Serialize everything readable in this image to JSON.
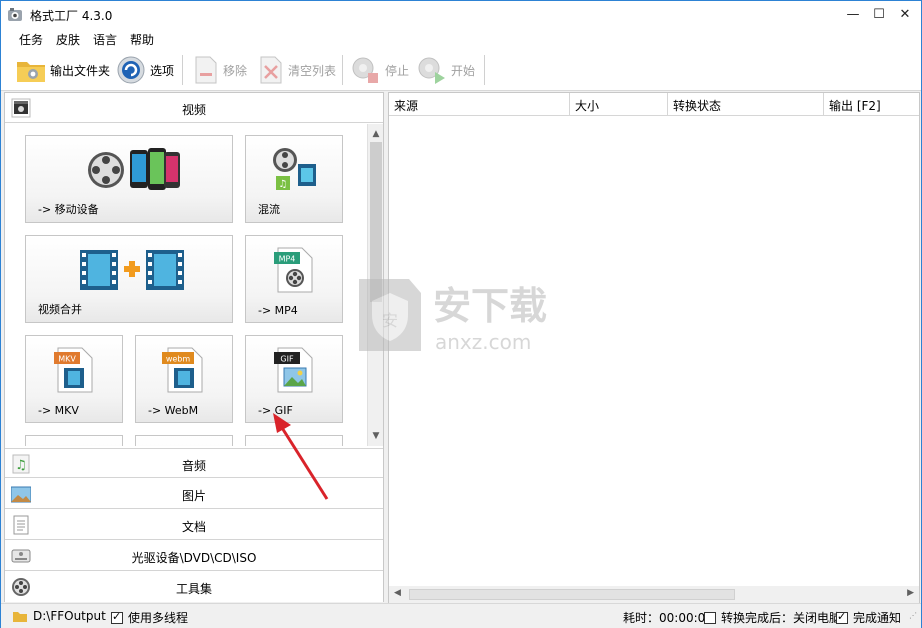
{
  "window": {
    "title": "格式工厂 4.3.0"
  },
  "menu": [
    "任务",
    "皮肤",
    "语言",
    "帮助"
  ],
  "toolbar": {
    "output_folder": "输出文件夹",
    "options": "选项",
    "remove": "移除",
    "clear_list": "清空列表",
    "stop": "停止",
    "start": "开始"
  },
  "categories": {
    "video": "视频",
    "audio": "音频",
    "image": "图片",
    "document": "文档",
    "rom": "光驱设备\\DVD\\CD\\ISO",
    "tools": "工具集"
  },
  "tiles": {
    "mobile": "-> 移动设备",
    "mix": "混流",
    "join": "视频合并",
    "mp4": "-> MP4",
    "mkv": "-> MKV",
    "webm": "-> WebM",
    "gif": "-> GIF"
  },
  "tile_badges": {
    "mp4": "MP4",
    "mkv": "MKV",
    "webm": "webm",
    "gif": "GIF"
  },
  "task_columns": [
    "来源",
    "大小",
    "转换状态",
    "输出 [F2]"
  ],
  "watermark": {
    "brand": "安下载",
    "domain": "anxz.com"
  },
  "status": {
    "output_path": "D:\\FFOutput",
    "multithread": "使用多线程",
    "multithread_checked": true,
    "elapsed": "耗时：00:00:00",
    "after_convert": "转换完成后：关闭电脑",
    "after_convert_checked": false,
    "notify": "完成通知",
    "notify_checked": true
  },
  "colors": {
    "accent_blue": "#2d82d4",
    "annotation_red": "#d9232a"
  }
}
